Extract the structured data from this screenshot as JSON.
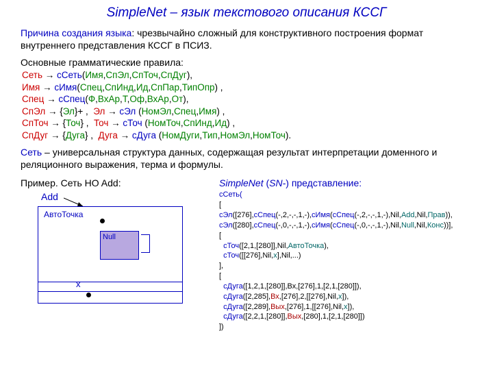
{
  "title": {
    "prefix": "SimpleNet",
    "rest": " – язык текстового описания КССГ"
  },
  "reason": {
    "label": "Причина создания языка",
    "text": ": чрезвычайно сложный для конструктивного построения формат внутреннего представления КССГ в ПСИЗ."
  },
  "rules_head": "Основные грамматические правила:",
  "g1": {
    "a": "Сеть",
    "b": "сСеть",
    "c": "Имя",
    "d": "СпЭл",
    "e": "СпТоч",
    "f": "СпДуг"
  },
  "g2": {
    "a": "Имя",
    "b": "сИмя",
    "c": "Спец",
    "d": "СпИнд",
    "e": "Ид",
    "f": "СпПар",
    "g": "ТипОпр"
  },
  "g3": {
    "a": "Спец",
    "b": "сСпец",
    "c": "Ф",
    "d": "ВхАр",
    "e": "Т",
    "f": "Оф",
    "g": "ВхАр",
    "h": "От"
  },
  "g4": {
    "a": "СпЭл",
    "b": "Эл",
    "c": "Эл",
    "d": "сЭл",
    "e": "НомЭл",
    "f": "Спец",
    "g": "Имя"
  },
  "g5": {
    "a": "СпТоч",
    "b": "Точ",
    "c": "Точ",
    "d": "сТоч",
    "e": "НомТоч",
    "f": "СпИнд",
    "g": "Ид"
  },
  "g6": {
    "a": "СпДуг",
    "b": "Дуга",
    "c": "Дуга",
    "d": "сДуга",
    "e": "НомДуги",
    "f": "Тип",
    "g": "НомЭл",
    "h": "НомТоч"
  },
  "net_expl": {
    "a": "Сеть",
    "b": " – универсальная структура данных, содержащая результат интерпретации доменного и реляционного выражения, терма и формулы."
  },
  "example_head": "Пример. Сеть HO Add:",
  "diagram": {
    "add": "Add",
    "auto": "АвтоТочка",
    "null": "Null",
    "x": "x"
  },
  "sn_head": {
    "a": "SimpleNet ",
    "b": "(",
    "c": "SN-",
    "d": ") представление:"
  },
  "code": {
    "l1": "сСеть(",
    "l2": "[",
    "l3_a": "сЭл",
    "l3_b": "([276],",
    "l3_c": "сСпец",
    "l3_d": "(-,2,-,-,1,-),",
    "l3_e": "сИмя",
    "l3_f": "(",
    "l3_g": "сСпец",
    "l3_h": "(-,2,-,-,1,-),Nil,",
    "l3_i": "Add",
    "l3_j": ",Nil,",
    "l3_k": "Прав",
    "l3_l": ")),",
    "l4_a": "сЭл",
    "l4_b": "([280],",
    "l4_c": "сСпец",
    "l4_d": "(-,0,-,-,1,-),",
    "l4_e": "сИмя",
    "l4_f": "(",
    "l4_g": "сСпец",
    "l4_h": "(-,0,-,-,1,-),Nil,",
    "l4_i": "Null",
    "l4_j": ",Nil,",
    "l4_k": "Конс",
    "l4_l": "))],",
    "l5": "[",
    "l6_a": "сТоч",
    "l6_b": "([2,1,[280]],Nil,",
    "l6_c": "АвтоТочка",
    "l6_d": "),",
    "l7_a": "сТоч",
    "l7_b": "([[276],Nil,",
    "l7_c": "x",
    "l7_d": "],Nil,...)",
    "l8": "],",
    "l9": "[",
    "l10_a": "сДуга",
    "l10_b": "([1,2,1,[280]],Вх,[276],1,[2,1,[280]]),",
    "l11_a": "сДуга",
    "l11_b": "([2,285],",
    "l11_c": "Вх",
    "l11_d": ",[276],2,[[276],Nil,",
    "l11_e": "x",
    "l11_f": "]),",
    "l12_a": "сДуга",
    "l12_b": "([2,289],",
    "l12_c": "Вых",
    "l12_d": ",[276],1,[[276],Nil,",
    "l12_e": "x",
    "l12_f": "]),",
    "l13_a": "сДуга",
    "l13_b": "([2,2,1,[280]],",
    "l13_c": "Вых",
    "l13_d": ",[280],1,[2,1,[280]])",
    "l14": "])"
  }
}
